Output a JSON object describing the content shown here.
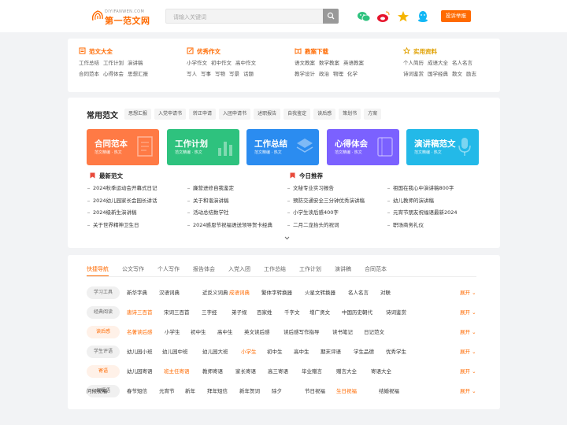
{
  "header": {
    "logo_en": "DIYIFANWEN.COM",
    "logo_cn": "第一范文网",
    "search_placeholder": "请输入关键词",
    "social_icons": [
      "wechat-icon",
      "weibo-icon",
      "star-icon",
      "qq-icon"
    ],
    "submit_label": "投诉举报"
  },
  "categories": [
    {
      "title": "范文大全",
      "icon": "doc-icon",
      "lines": [
        [
          "工作总结",
          "工作计划",
          "演讲稿"
        ],
        [
          "合同范本",
          "心得体会",
          "思想汇报"
        ]
      ]
    },
    {
      "title": "优秀作文",
      "icon": "edit-icon",
      "lines": [
        [
          "小学作文",
          "初中作文",
          "高中作文"
        ],
        [
          "写人",
          "写事",
          "写物",
          "写景",
          "话题"
        ]
      ]
    },
    {
      "title": "教案下载",
      "icon": "book-icon",
      "lines": [
        [
          "语文教案",
          "数学教案",
          "英语教案"
        ],
        [
          "教学设计",
          "政治",
          "物理",
          "化学"
        ]
      ]
    },
    {
      "title": "实用资料",
      "icon": "star-icon",
      "lines": [
        [
          "个人简历",
          "成语大全",
          "名人名言"
        ],
        [
          "诗词鉴赏",
          "国学经典",
          "散文",
          "励志"
        ]
      ]
    }
  ],
  "common": {
    "title": "常用范文",
    "tags": [
      "思想汇报",
      "入党申请书",
      "转正申请",
      "入团申请书",
      "述职报告",
      "自我鉴定",
      "读后感",
      "策划书",
      "方案"
    ],
    "banners": [
      {
        "title": "合同范本",
        "sub": "范文精编 · 热文",
        "color": "#ff7a45"
      },
      {
        "title": "工作计划",
        "sub": "范文精编 · 热文",
        "color": "#2ec27e"
      },
      {
        "title": "工作总结",
        "sub": "范文精编 · 热文",
        "color": "#2b8cf0"
      },
      {
        "title": "心得体会",
        "sub": "范文精编 · 热文",
        "color": "#7b61ff"
      },
      {
        "title": "演讲稿范文",
        "sub": "范文精编 · 热文",
        "color": "#23b9e8"
      }
    ]
  },
  "news": {
    "latest_title": "最新范文",
    "today_title": "今日推荐",
    "col1": [
      "2024秋季运动会开幕式日记",
      "2024幼儿园家长会园长讲话",
      "2024级新生演讲稿",
      "关于世界精神卫生日"
    ],
    "col2": [
      "廉营进修自我鉴定",
      "关于和谐演讲稿",
      "活动总结数学社",
      "2024感恩节祝福语送领导贺卡经典"
    ],
    "col3": [
      "文秘专业实习报告",
      "预防交通安全三分钟优秀演讲稿",
      "小学生读后感400字",
      "二月二龙抬头的祝词"
    ],
    "col4": [
      "祖国在我心中演讲稿800字",
      "幼儿教师的演讲稿",
      "元宵节朋友祝福语最新2024",
      "职场商务礼仪"
    ]
  },
  "nav": {
    "tabs": [
      "快捷导航",
      "公文写作",
      "个人写作",
      "报告体会",
      "入党入团",
      "工作总结",
      "工作计划",
      "演讲稿",
      "合同范本"
    ],
    "more_label": "展开"
  },
  "rows": [
    {
      "label": "学习工具",
      "hot": false,
      "items": [
        {
          "t": "新华字典"
        },
        {
          "t": "汉语词典"
        },
        {
          "t": "近反义词典"
        },
        {
          "t": "成语词典",
          "hl": true
        },
        {
          "t": "繁体字转换器"
        },
        {
          "t": "火星文转换器"
        },
        {
          "t": "名人名言"
        },
        {
          "t": "对联"
        }
      ]
    },
    {
      "label": "经典阅读",
      "hot": false,
      "items": [
        {
          "t": "唐诗三百首",
          "hl": true
        },
        {
          "t": "宋词三百首"
        },
        {
          "t": "三字经"
        },
        {
          "t": "弟子规"
        },
        {
          "t": "百家姓"
        },
        {
          "t": "千字文"
        },
        {
          "t": "增广贤文"
        },
        {
          "t": "中国历史朝代"
        },
        {
          "t": "诗词鉴赏"
        }
      ]
    },
    {
      "label": "读后感",
      "hot": true,
      "items": [
        {
          "t": "名著读后感",
          "hl": true
        },
        {
          "t": "小学生"
        },
        {
          "t": "初中生"
        },
        {
          "t": "高中生"
        },
        {
          "t": "英文读后感"
        },
        {
          "t": "读后感写作指导"
        },
        {
          "t": "读书笔记"
        },
        {
          "t": "日记范文"
        }
      ]
    },
    {
      "label": "学生评语",
      "hot": false,
      "items": [
        {
          "t": "幼儿园小班"
        },
        {
          "t": "幼儿园中班"
        },
        {
          "t": "幼儿园大班"
        },
        {
          "t": "小学生",
          "hl": true
        },
        {
          "t": "初中生"
        },
        {
          "t": "高中生"
        },
        {
          "t": "期末评语"
        },
        {
          "t": "学生品德"
        },
        {
          "t": "优秀学生"
        }
      ]
    },
    {
      "label": "寄语",
      "hot": true,
      "items": [
        {
          "t": "幼儿园寄语"
        },
        {
          "t": "班主任寄语",
          "hl": true
        },
        {
          "t": "教师寄语"
        },
        {
          "t": "家长寄语"
        },
        {
          "t": "高三寄语"
        },
        {
          "t": "毕业赠言"
        },
        {
          "t": "赠言大全"
        },
        {
          "t": "寄语大全"
        }
      ]
    },
    {
      "label": "祝福语",
      "hot": false,
      "items": [
        {
          "t": "春节短信"
        },
        {
          "t": "元宵节"
        },
        {
          "t": "新年"
        },
        {
          "t": "拜年短信"
        },
        {
          "t": "新年贺词"
        },
        {
          "t": "除夕"
        },
        {
          "t": "节日祝福"
        },
        {
          "t": "生日祝福",
          "hl": true
        },
        {
          "t": "结婚祝福"
        },
        {
          "t": "问候祝福"
        }
      ]
    }
  ]
}
